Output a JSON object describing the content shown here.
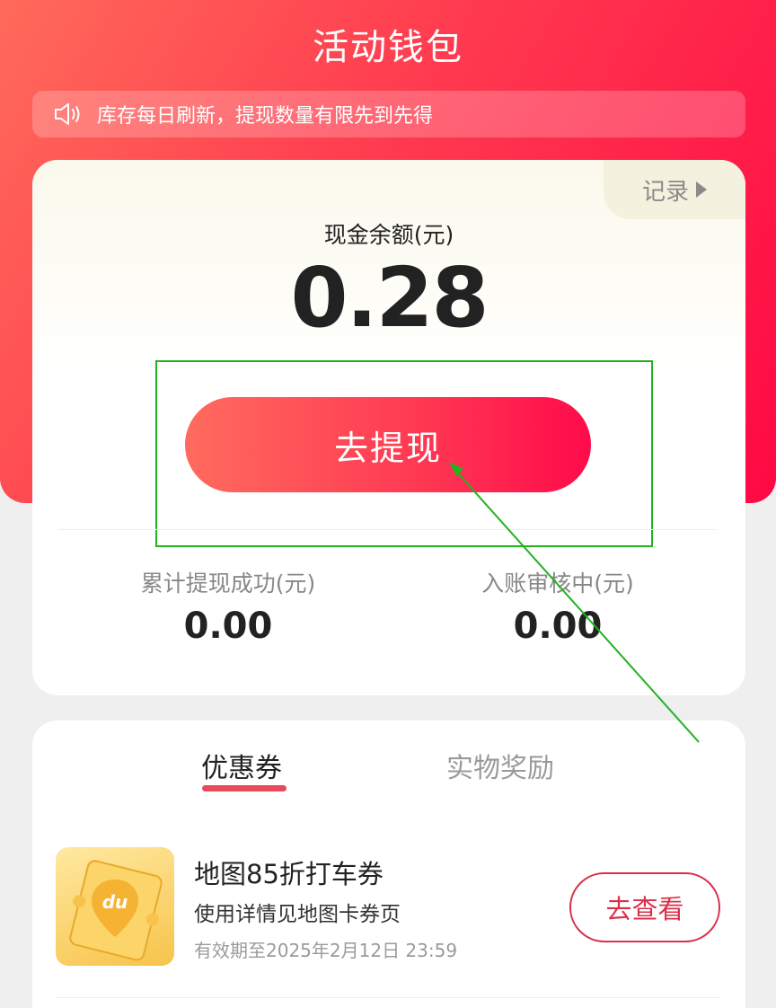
{
  "header": {
    "title": "活动钱包"
  },
  "notice": {
    "text": "库存每日刷新，提现数量有限先到先得",
    "icon": "speaker-icon"
  },
  "wallet": {
    "record_label": "记录",
    "balance_label": "现金余额(元)",
    "balance_value": "0.28",
    "withdraw_label": "去提现",
    "stats": [
      {
        "label": "累计提现成功(元)",
        "value": "0.00"
      },
      {
        "label": "入账审核中(元)",
        "value": "0.00"
      }
    ]
  },
  "tabs": [
    {
      "label": "优惠券",
      "active": true
    },
    {
      "label": "实物奖励",
      "active": false
    }
  ],
  "coupons": [
    {
      "title": "地图85折打车券",
      "desc": "使用详情见地图卡券页",
      "expiry": "有效期至2025年2月12日 23:59",
      "action": "去查看",
      "icon": "map-pin-ticket-icon",
      "icon_text": "du"
    }
  ],
  "colors": {
    "accent": "#ff3a4f",
    "brand_red": "#d9304a",
    "highlight": "#22b222"
  }
}
